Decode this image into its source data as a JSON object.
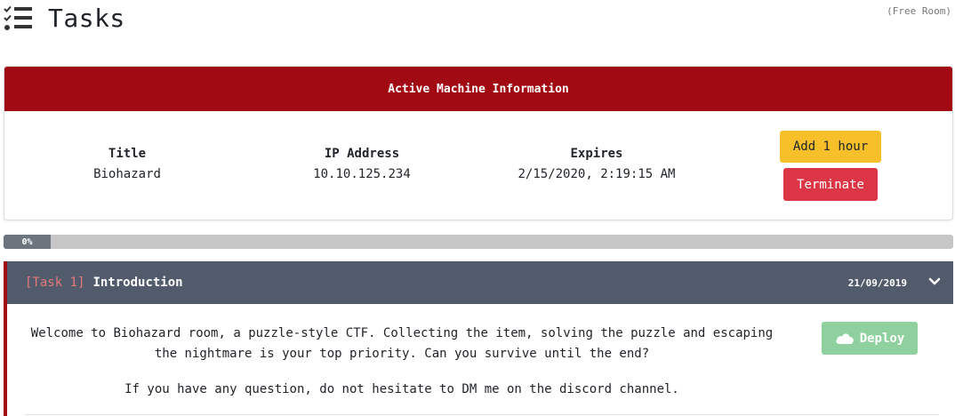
{
  "header": {
    "title": "Tasks",
    "icon": "task-list-icon",
    "room_type": "(Free Room)"
  },
  "machine": {
    "heading": "Active Machine Information",
    "title_label": "Title",
    "title_value": "Biohazard",
    "ip_label": "IP Address",
    "ip_value": "10.10.125.234",
    "expires_label": "Expires",
    "expires_value": "2/15/2020, 2:19:15 AM",
    "add_hour_label": "Add 1 hour",
    "terminate_label": "Terminate",
    "colors": {
      "header": "#a20a13",
      "add": "#f7c02b",
      "terminate": "#dc3545"
    }
  },
  "progress": {
    "label": "0%",
    "value": 0
  },
  "task": {
    "number": "[Task 1]",
    "name": "Introduction",
    "date": "21/09/2019",
    "expand_icon": "chevron-down-icon",
    "deploy_label": "Deploy",
    "deploy_icon": "cloud-icon",
    "description_1": "Welcome to Biohazard room, a puzzle-style CTF. Collecting the item, solving the puzzle and escaping the nightmare is your top priority. Can you survive until the end?",
    "description_2": "If you have any question, do not hesitate to DM me on the discord channel."
  }
}
